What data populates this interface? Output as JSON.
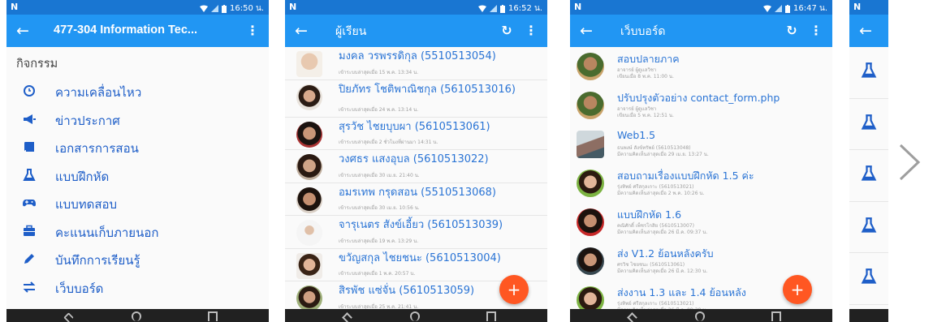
{
  "status_bar": {
    "p1_time": "16:50 น.",
    "p2_time": "16:52 น.",
    "p3_time": "16:47 น."
  },
  "screen1": {
    "title": "477-304 Information Tec...",
    "section_title": "กิจกรรม",
    "menu": [
      {
        "icon": "clock-icon",
        "label": "ความเคลื่อนไหว"
      },
      {
        "icon": "megaphone-icon",
        "label": "ข่าวประกาศ"
      },
      {
        "icon": "book-icon",
        "label": "เอกสารการสอน"
      },
      {
        "icon": "flask-icon",
        "label": "แบบฝึกหัด"
      },
      {
        "icon": "gamepad-icon",
        "label": "แบบทดสอบ"
      },
      {
        "icon": "briefcase-icon",
        "label": "คะแนนเก็บภายนอก"
      },
      {
        "icon": "pencil-icon",
        "label": "บันทึกการเรียนรู้"
      },
      {
        "icon": "swap-icon",
        "label": "เว็บบอร์ด"
      }
    ]
  },
  "screen2": {
    "title": "ผู้เรียน",
    "students": [
      {
        "name": "มงคล วรพรรดิกุล (5510513054)",
        "sub": "เข้าระบบล่าสุดเมื่อ 15 พ.ค. 13:34 น."
      },
      {
        "name": "ปิยภัทร โชติพาณิชกุล (5610513016)",
        "sub": "เข้าระบบล่าสุดเมื่อ 24 พ.ค. 13:14 น."
      },
      {
        "name": "สุรวัช ไชยบุบผา (5610513061)",
        "sub": "เข้าระบบล่าสุดเมื่อ 2 ชั่วโมงที่ผ่านมา 14:31 น."
      },
      {
        "name": "วงศธร แสงอุบล (5610513022)",
        "sub": "เข้าระบบล่าสุดเมื่อ 30 เม.ย. 21:40 น."
      },
      {
        "name": "อมรเทพ กรุดสอน (5510513068)",
        "sub": "เข้าระบบล่าสุดเมื่อ 30 เม.ย. 10:56 น."
      },
      {
        "name": "จารุเนตร สังข์เอี้ยว (5610513039)",
        "sub": "เข้าระบบล่าสุดเมื่อ 19 พ.ค. 13:29 น."
      },
      {
        "name": "ขวัญสกุล ไชยชนะ (5610513004)",
        "sub": "เข้าระบบล่าสุดเมื่อ 1 พ.ค. 20:57 น."
      },
      {
        "name": "สิรพัช แซ่จั่น (5610513059)",
        "sub": "เข้าระบบล่าสุดเมื่อ 25 พ.ค. 21:41 น."
      }
    ],
    "fab": "+"
  },
  "screen3": {
    "title": "เว็บบอร์ด",
    "posts": [
      {
        "title": "สอบปลายภาค",
        "by": "อาจารย์ ผู้ดูแลวิชา",
        "meta": "เขียนเมื่อ 8 พ.ค. 11:00 น."
      },
      {
        "title": "ปรับปรุงตัวอย่าง contact_form.php",
        "by": "อาจารย์ ผู้ดูแลวิชา",
        "meta": "เขียนเมื่อ 5 พ.ค. 12:51 น."
      },
      {
        "title": "Web1.5",
        "by": "ธนพงษ์ สังข์ทรัพย์ (5610513048)",
        "meta": "มีความคิดเห็นล่าสุดเมื่อ 29 เม.ย. 13:27 น."
      },
      {
        "title": "สอบถามเรื่องแบบฝึกหัด 1.5 ค่ะ",
        "by": "รุ่งทิพย์ ศรีสกุลเกาะ (5610513021)",
        "meta": "มีความคิดเห็นล่าสุดเมื่อ 2 พ.ค. 10:26 น."
      },
      {
        "title": "แบบฝึกหัด 1.6",
        "by": "คณิศักดิ์ เพ็ชรโกสิย (5610513007)",
        "meta": "มีความคิดเห็นล่าสุดเมื่อ 26 มี.ค. 09:37 น."
      },
      {
        "title": "ส่ง V1.2 ย้อนหลังครับ",
        "by": "ศรวิช ไชยชนะ (5610513061)",
        "meta": "มีความคิดเห็นล่าสุดเมื่อ 26 มี.ค. 12:30 น."
      },
      {
        "title": "ส่งงาน 1.3 และ 1.4 ย้อนหลัง",
        "by": "รุ่งทิพย์ ศรีสกุลเกาะ (5610513021)",
        "meta": "มีความคิดเห็นล่าสุดเมื่อ 26 มี.ค. 09:38 น."
      }
    ],
    "fab": "+"
  },
  "colors": {
    "appbar": "#2196f3",
    "statusbar": "#1976d2",
    "link": "#2a74d5",
    "fab": "#ff5722"
  }
}
